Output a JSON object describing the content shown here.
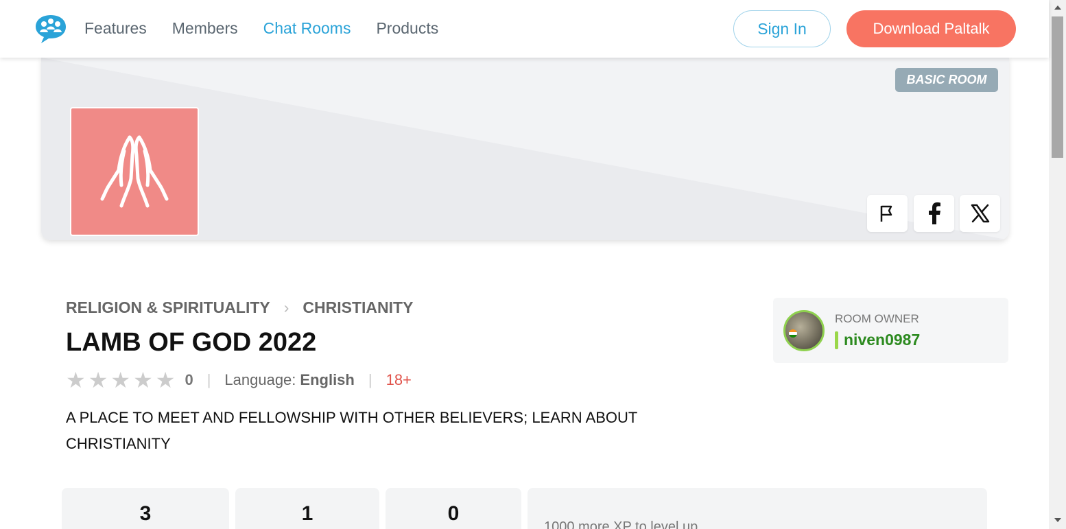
{
  "header": {
    "nav": [
      {
        "label": "Features",
        "active": false
      },
      {
        "label": "Members",
        "active": false
      },
      {
        "label": "Chat Rooms",
        "active": true
      },
      {
        "label": "Products",
        "active": false
      }
    ],
    "sign_in": "Sign In",
    "download": "Download Paltalk"
  },
  "banner": {
    "badge": "BASIC ROOM",
    "room_icon": "praying-hands-icon",
    "share_buttons": [
      "flag-icon",
      "facebook-icon",
      "x-icon"
    ]
  },
  "room": {
    "breadcrumb": [
      "RELIGION & SPIRITUALITY",
      "CHRISTIANITY"
    ],
    "title": "LAMB OF GOD 2022",
    "rating": 0,
    "rating_max": 5,
    "rating_count": "0",
    "language_label": "Language:",
    "language": "English",
    "age": "18+",
    "description": "A PLACE TO MEET AND FELLOWSHIP WITH OTHER BELIEVERS; LEARN ABOUT CHRISTIANITY"
  },
  "owner": {
    "label": "ROOM OWNER",
    "name": "niven0987"
  },
  "stats": [
    "3",
    "1",
    "0"
  ],
  "xp": {
    "text": "1000 more XP to level up"
  },
  "colors": {
    "accent": "#2aa3d8",
    "download": "#f87462",
    "room_icon_bg": "#f08a87",
    "owner_name": "#2c8a1f",
    "age": "#e0524a"
  }
}
